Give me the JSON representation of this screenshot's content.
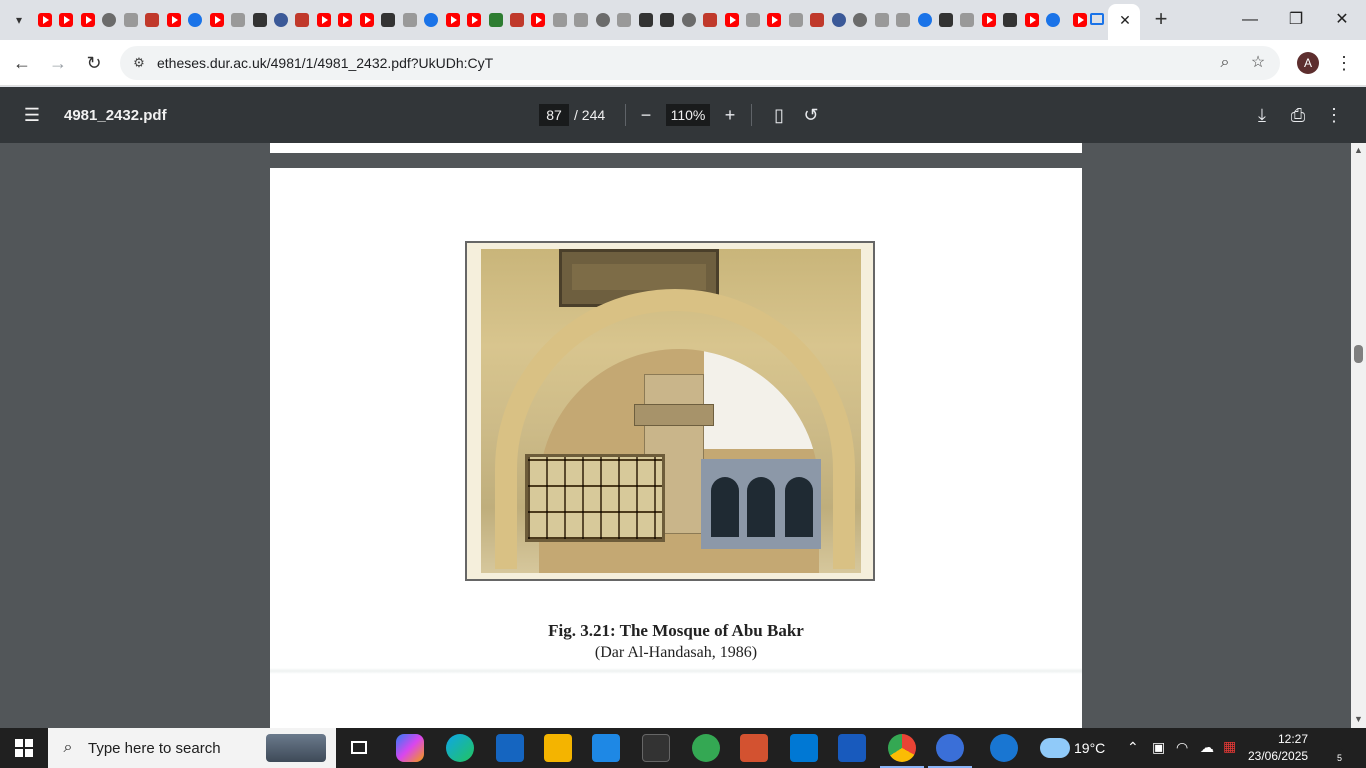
{
  "browser": {
    "url": "etheses.dur.ac.uk/4981/1/4981_2432.pdf?UkUDh:CyT",
    "avatar_letter": "A",
    "new_tab_symbol": "+",
    "tab_close_symbol": "✕",
    "window_controls": {
      "minimize": "—",
      "maximize": "❐",
      "close": "✕"
    }
  },
  "pdf_viewer": {
    "filename": "4981_2432.pdf",
    "current_page": "87",
    "total_pages": "/ 244",
    "zoom": "110%"
  },
  "document": {
    "caption_title": "Fig. 3.21: The Mosque of Abu Bakr",
    "caption_source": "(Dar Al-Handasah, 1986)"
  },
  "taskbar": {
    "search_placeholder": "Type here to search",
    "weather": "19°C",
    "time": "12:27",
    "date": "23/06/2025",
    "notification_count": "5"
  },
  "colors": {
    "pdf_toolbar": "#323639",
    "viewer_bg": "#525659",
    "taskbar": "#202020",
    "youtube_red": "#ff0000"
  }
}
